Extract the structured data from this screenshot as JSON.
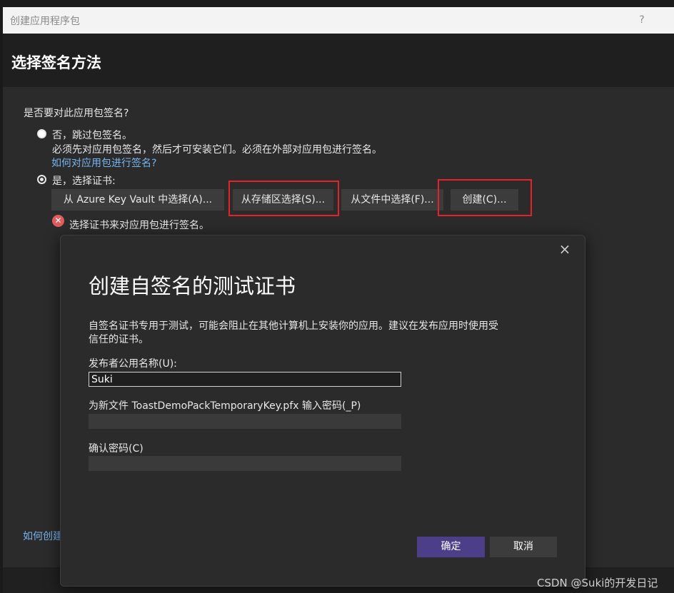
{
  "window": {
    "title": "创建应用程序包",
    "help_label": "?"
  },
  "header": {
    "title": "选择签名方法"
  },
  "signing": {
    "question": "是否要对此应用包签名?",
    "option_no": {
      "label": "否，跳过包签名。",
      "description": "必须先对应用包签名，然后才可安装它们。必须在外部对应用包进行签名。",
      "link": "如何对应用包进行签名?"
    },
    "option_yes": {
      "label": "是，选择证书:"
    },
    "buttons": {
      "azure": "从 Azure Key Vault 中选择(A)...",
      "store": "从存储区选择(S)...",
      "file": "从文件中选择(F)...",
      "create": "创建(C)..."
    },
    "error": "选择证书来对应用包进行签名。"
  },
  "footer": {
    "link_partial": "如何创建"
  },
  "modal": {
    "close_icon": "×",
    "title": "创建自签名的测试证书",
    "description_line1": "自签名证书专用于测试，可能会阻止在其他计算机上安装你的应用。建议在发布应用时使用受",
    "description_line2": "信任的证书。",
    "publisher_label": "发布者公用名称(U):",
    "publisher_value": "Suki",
    "password_label": "为新文件 ToastDemoPackTemporaryKey.pfx 输入密码(_P)",
    "password_value": "",
    "confirm_label": "确认密码(C)",
    "confirm_value": "",
    "ok_label": "确定",
    "cancel_label": "取消"
  },
  "watermark": "CSDN @Suki的开发日记",
  "colors": {
    "accent": "#4d3e8a",
    "highlight": "#e2232a",
    "link": "#78b4f0",
    "error": "#e05c5c"
  }
}
